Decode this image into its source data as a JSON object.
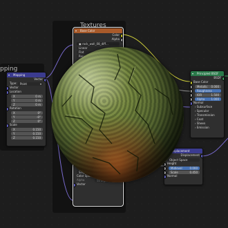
{
  "frames": {
    "mapping_partial": "pping",
    "textures": "Textures"
  },
  "mapping_node": {
    "title": "Mapping",
    "vector_out": "Vector",
    "type_label": "Type:",
    "type_value": "Point",
    "vector_in": "Vector",
    "location_label": "Location",
    "location": [
      [
        "X",
        "0 m"
      ],
      [
        "Y",
        "0 m"
      ],
      [
        "Z",
        "0 m"
      ]
    ],
    "rotation_label": "Rotation",
    "rotation": [
      [
        "X",
        "0°"
      ],
      [
        "Y",
        "-0°"
      ],
      [
        "Z",
        "0°"
      ]
    ],
    "scale_label": "Scale",
    "scale": [
      [
        "X",
        "0.150"
      ],
      [
        "Y",
        "0.150"
      ],
      [
        "Z",
        "0.150"
      ]
    ]
  },
  "image_node": {
    "title": "Base Color",
    "color_out": "Color",
    "alpha_out": "Alpha",
    "image_name": "rock_wall_08_diff...",
    "interp": "Linear",
    "proj": "Flat",
    "ext": "Repeat",
    "source": "Single Image",
    "colorspace_label": "Color Space",
    "colorspace": "sRGB",
    "alpha_label": "Alpha",
    "alpha_value": "Straight",
    "vector_in": "Vector",
    "lower_rows": [
      "Linear",
      "Flat",
      "Repeat",
      "Single Image"
    ],
    "cs2_label": "Color Space",
    "cs2_value": "Non-Color",
    "alpha2_label": "Alpha",
    "alpha2_value": "Straight",
    "vector2_in": "Vector"
  },
  "bsdf_node": {
    "title": "Principled BSDF",
    "bsdf_out": "BSDF",
    "rows": [
      "Base Color",
      "Metallic",
      "Roughness",
      "IOR",
      "Alpha",
      "Normal"
    ],
    "metallic_value": "0.000",
    "ior_value": "1.500",
    "alpha_value": "1.000",
    "sections": [
      "Subsurface",
      "Specular",
      "Transmission",
      "Coat",
      "Sheen",
      "Emission"
    ]
  },
  "displacement_node": {
    "title": "Displacement",
    "out_label": "Displacement",
    "space_label": "Object Space",
    "height_label": "Height",
    "midlevel_label": "Midlevel",
    "midlevel_value": "0.000",
    "scale_label": "Scale",
    "scale_value": "0.450",
    "normal_label": "Normal"
  },
  "colors": {
    "texture_header": "#a85a2a",
    "vector_header": "#3b3b8f",
    "shader_header": "#2a7a4a",
    "color_socket": "#c7c729",
    "vector_socket": "#6363c7",
    "float_socket": "#a1a1a1",
    "wire_yellow": "#cfcf3a",
    "wire_purple": "#7a6bd0",
    "wire_grey": "#8e8e8e"
  }
}
